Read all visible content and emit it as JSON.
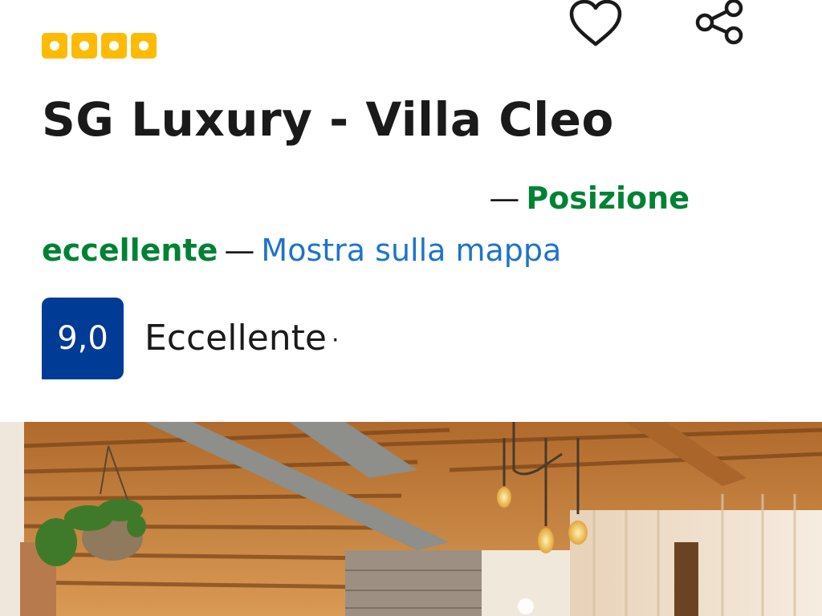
{
  "hotel": {
    "star_count": 4,
    "name": "SG Luxury - Villa Cleo",
    "location_dash_1": "—",
    "location_quality_part1": "Posizione",
    "location_quality_part2": "eccellente",
    "location_dash_2": "—",
    "map_link": "Mostra sulla mappa"
  },
  "review": {
    "score": "9,0",
    "label": "Eccellente",
    "separator": "·"
  },
  "icons": {
    "favorite": "heart-icon",
    "share": "share-icon",
    "rating": "star-badge-icon"
  },
  "colors": {
    "star_badge": "#febb02",
    "location_green": "#008234",
    "link_blue": "#1f73c9",
    "score_blue": "#003b95"
  }
}
